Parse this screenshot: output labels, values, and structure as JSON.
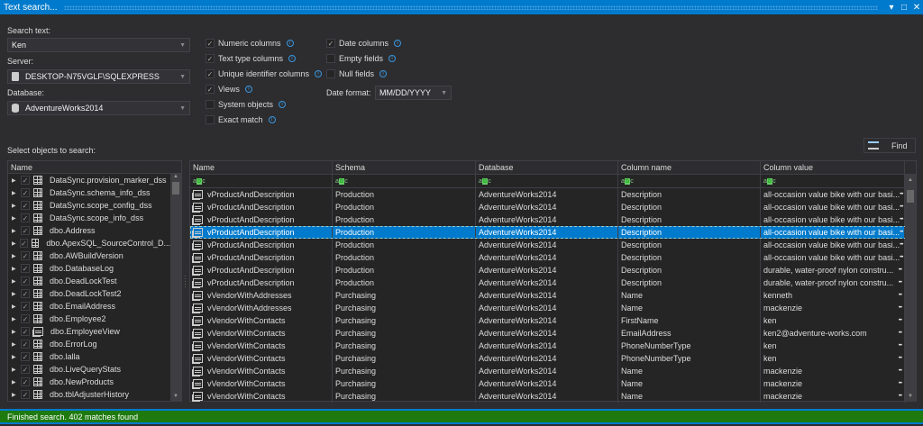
{
  "window": {
    "title": "Text search...",
    "controls": [
      "▾",
      "□",
      "✕"
    ]
  },
  "form": {
    "search_label": "Search text:",
    "search_value": "Ken",
    "server_label": "Server:",
    "server_value": "DESKTOP-N75VGLF\\SQLEXPRESS",
    "database_label": "Database:",
    "database_value": "AdventureWorks2014",
    "date_format_label": "Date format:",
    "date_format_value": "MM/DD/YYYY",
    "options_col1": [
      {
        "label": "Numeric columns",
        "checked": true
      },
      {
        "label": "Text type columns",
        "checked": true
      },
      {
        "label": "Unique identifier columns",
        "checked": true
      },
      {
        "label": "Views",
        "checked": true
      },
      {
        "label": "System objects",
        "checked": false
      },
      {
        "label": "Exact match",
        "checked": false
      }
    ],
    "options_col2": [
      {
        "label": "Date columns",
        "checked": true
      },
      {
        "label": "Empty fields",
        "checked": false
      },
      {
        "label": "Null fields",
        "checked": false
      }
    ]
  },
  "objects": {
    "label": "Select objects to search:",
    "header": "Name",
    "items": [
      {
        "name": "DataSync.provision_marker_dss",
        "icon": "table"
      },
      {
        "name": "DataSync.schema_info_dss",
        "icon": "table"
      },
      {
        "name": "DataSync.scope_config_dss",
        "icon": "table"
      },
      {
        "name": "DataSync.scope_info_dss",
        "icon": "table"
      },
      {
        "name": "dbo.Address",
        "icon": "table"
      },
      {
        "name": "dbo.ApexSQL_SourceControl_D...",
        "icon": "table"
      },
      {
        "name": "dbo.AWBuildVersion",
        "icon": "table"
      },
      {
        "name": "dbo.DatabaseLog",
        "icon": "table"
      },
      {
        "name": "dbo.DeadLockTest",
        "icon": "table"
      },
      {
        "name": "dbo.DeadLockTest2",
        "icon": "table"
      },
      {
        "name": "dbo.EmailAddress",
        "icon": "table"
      },
      {
        "name": "dbo.Employee2",
        "icon": "table"
      },
      {
        "name": "dbo.EmployeeView",
        "icon": "view"
      },
      {
        "name": "dbo.ErrorLog",
        "icon": "table"
      },
      {
        "name": "dbo.lalla",
        "icon": "table"
      },
      {
        "name": "dbo.LiveQueryStats",
        "icon": "table"
      },
      {
        "name": "dbo.NewProducts",
        "icon": "table"
      },
      {
        "name": "dbo.tblAdjusterHistory",
        "icon": "table"
      }
    ]
  },
  "find_button": "Find",
  "results": {
    "columns": [
      "Name",
      "Schema",
      "Database",
      "Column name",
      "Column value"
    ],
    "filter_glyph": "abc",
    "selected_index": 3,
    "rows": [
      [
        "vProductAndDescription",
        "Production",
        "AdventureWorks2014",
        "Description",
        "all-occasion value bike with our basi..."
      ],
      [
        "vProductAndDescription",
        "Production",
        "AdventureWorks2014",
        "Description",
        "all-occasion value bike with our basi..."
      ],
      [
        "vProductAndDescription",
        "Production",
        "AdventureWorks2014",
        "Description",
        "all-occasion value bike with our basi..."
      ],
      [
        "vProductAndDescription",
        "Production",
        "AdventureWorks2014",
        "Description",
        "all-occasion value bike with our basi..."
      ],
      [
        "vProductAndDescription",
        "Production",
        "AdventureWorks2014",
        "Description",
        "all-occasion value bike with our basi..."
      ],
      [
        "vProductAndDescription",
        "Production",
        "AdventureWorks2014",
        "Description",
        "all-occasion value bike with our basi..."
      ],
      [
        "vProductAndDescription",
        "Production",
        "AdventureWorks2014",
        "Description",
        "durable, water-proof nylon constru..."
      ],
      [
        "vProductAndDescription",
        "Production",
        "AdventureWorks2014",
        "Description",
        "durable, water-proof nylon constru..."
      ],
      [
        "vVendorWithAddresses",
        "Purchasing",
        "AdventureWorks2014",
        "Name",
        "kenneth"
      ],
      [
        "vVendorWithAddresses",
        "Purchasing",
        "AdventureWorks2014",
        "Name",
        "mackenzie"
      ],
      [
        "vVendorWithContacts",
        "Purchasing",
        "AdventureWorks2014",
        "FirstName",
        "ken"
      ],
      [
        "vVendorWithContacts",
        "Purchasing",
        "AdventureWorks2014",
        "EmailAddress",
        "ken2@adventure-works.com"
      ],
      [
        "vVendorWithContacts",
        "Purchasing",
        "AdventureWorks2014",
        "PhoneNumberType",
        "ken"
      ],
      [
        "vVendorWithContacts",
        "Purchasing",
        "AdventureWorks2014",
        "PhoneNumberType",
        "ken"
      ],
      [
        "vVendorWithContacts",
        "Purchasing",
        "AdventureWorks2014",
        "Name",
        "mackenzie"
      ],
      [
        "vVendorWithContacts",
        "Purchasing",
        "AdventureWorks2014",
        "Name",
        "mackenzie"
      ],
      [
        "vVendorWithContacts",
        "Purchasing",
        "AdventureWorks2014",
        "Name",
        "mackenzie"
      ]
    ]
  },
  "status": {
    "text": "Finished search. 402 matches found",
    "color": "#1e7a0f"
  },
  "colors": {
    "accent": "#007acc",
    "background": "#2d2d30"
  }
}
